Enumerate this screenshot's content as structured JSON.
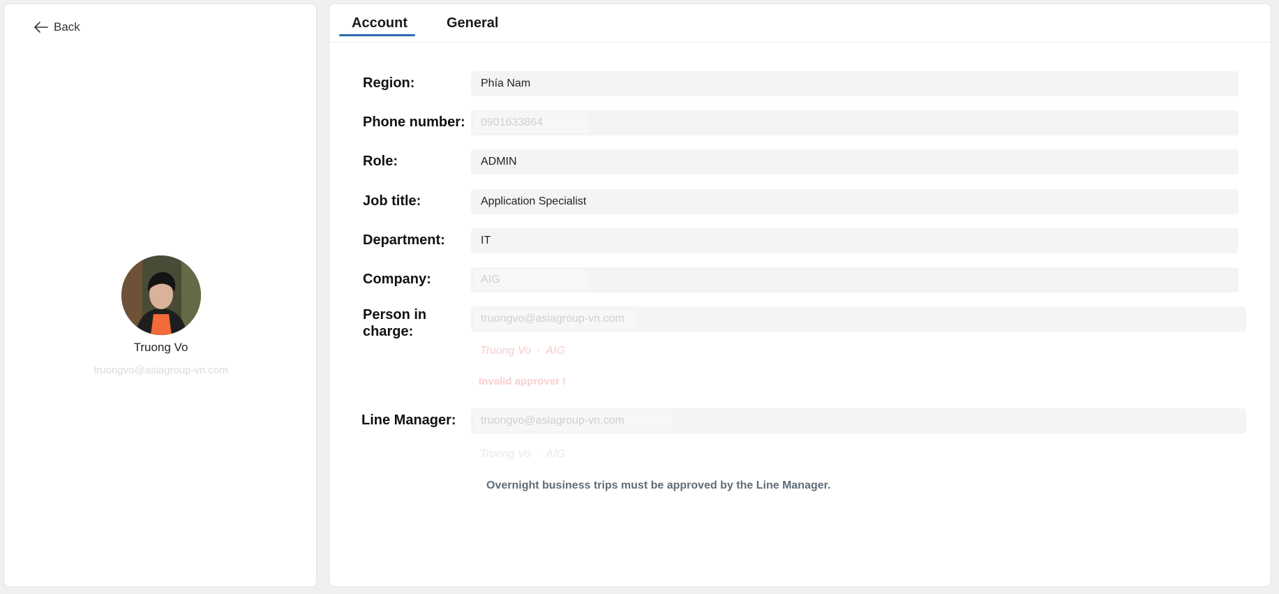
{
  "left": {
    "back_label": "Back",
    "profile_name": "Truong Vo",
    "profile_email": "truongvo@asiagroup-vn.com"
  },
  "tabs": [
    {
      "label": "Account",
      "active": true
    },
    {
      "label": "General",
      "active": false
    }
  ],
  "form": {
    "region": {
      "label": "Region:",
      "value": "Phía Nam"
    },
    "phone": {
      "label": "Phone number:",
      "value": "0901633864"
    },
    "role": {
      "label": "Role:",
      "value": "ADMIN"
    },
    "job_title": {
      "label": "Job title:",
      "value": "Application Specialist"
    },
    "department": {
      "label": "Department:",
      "value": "IT"
    },
    "company": {
      "label": "Company:",
      "value": "AIG"
    },
    "person_in_charge": {
      "label_line1": "Person in",
      "label_line2": "charge:",
      "value": "truongvo@asiagroup-vn.com",
      "hint_name": "Truong Vo",
      "hint_sep": "·",
      "hint_company": "AIG",
      "error": "Invalid approver !"
    },
    "line_manager": {
      "label": "Line Manager:",
      "value": "truongvo@asiagroup-vn.com",
      "hint_name": "Truong Vo",
      "hint_sep": "·",
      "hint_company": "AIG",
      "note": "Overnight business trips must be approved by the Line Manager."
    }
  },
  "colors": {
    "accent": "#2b6cb0",
    "field_bg": "#f4f4f4",
    "error": "#f7cfcf",
    "note": "#5f6c78"
  },
  "icons": {
    "back": "arrow-left-icon"
  }
}
